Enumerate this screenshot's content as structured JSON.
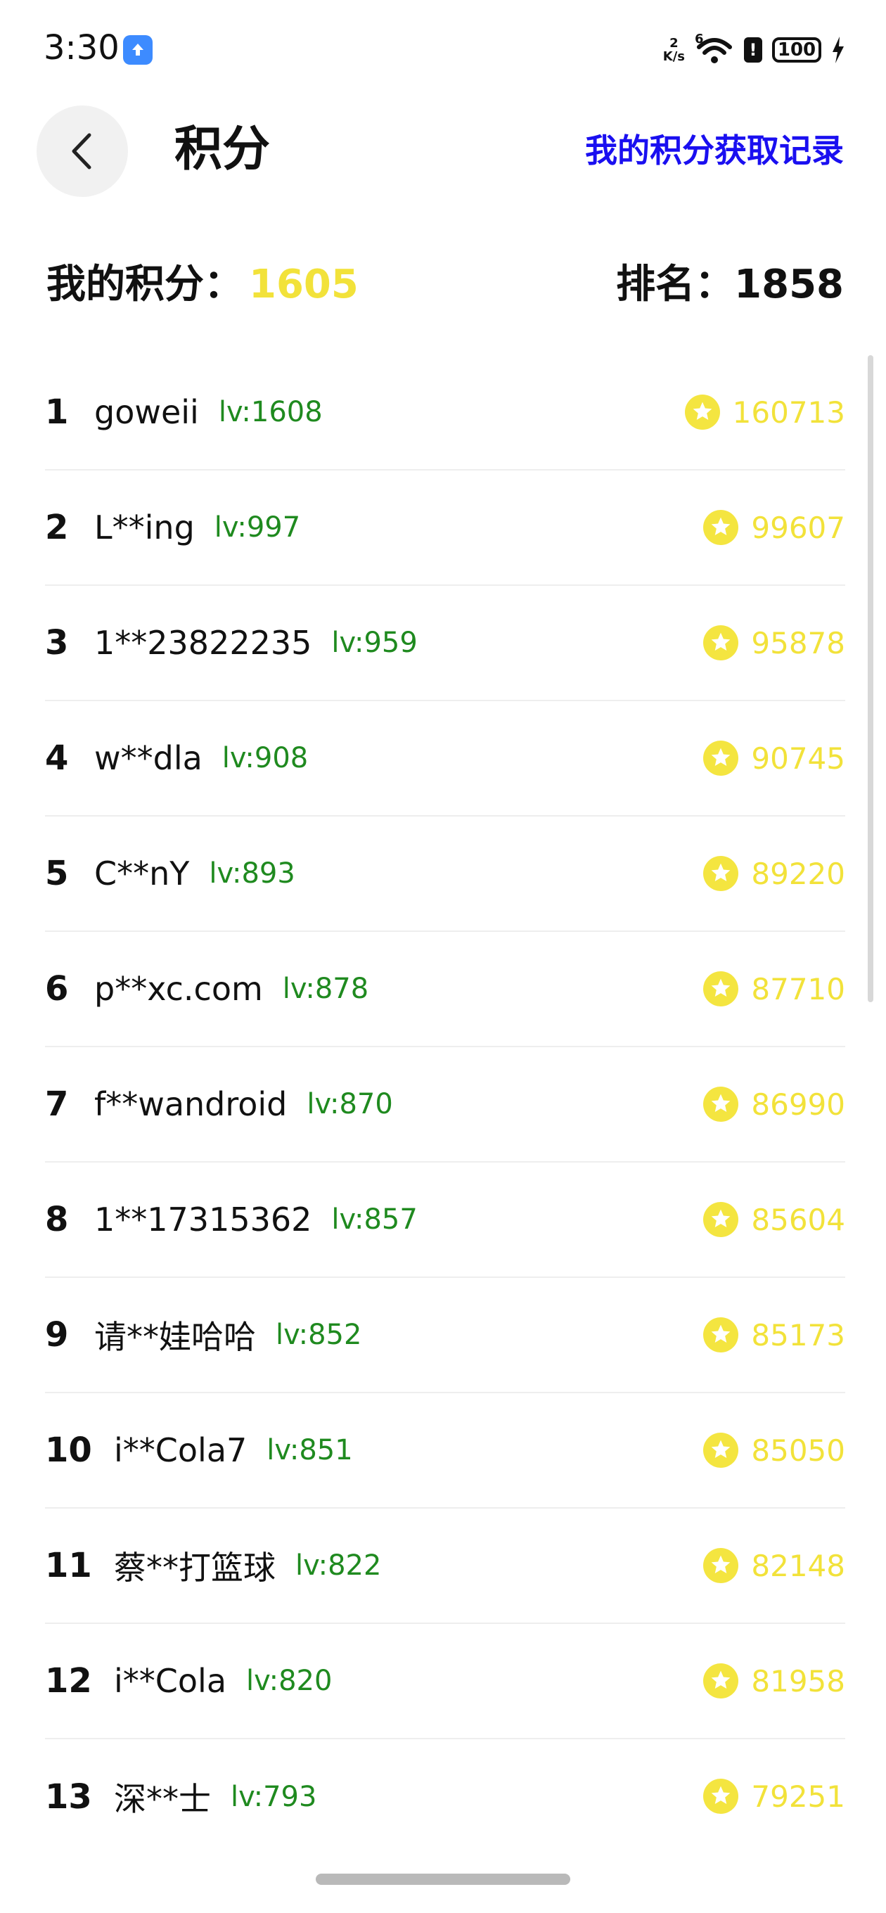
{
  "status_bar": {
    "time": "3:30",
    "speed_value": "2",
    "speed_unit": "K/s",
    "network": "6",
    "battery": "100",
    "icons": [
      "app-badge-icon",
      "wifi-icon",
      "alert-icon",
      "battery-icon",
      "charging-icon"
    ]
  },
  "header": {
    "title": "积分",
    "records_link": "我的积分获取记录"
  },
  "summary": {
    "my_points_label": "我的积分：",
    "my_points_value": "1605",
    "rank_label": "排名：",
    "rank_value": "1858"
  },
  "colors": {
    "accent_link": "#1a0ff0",
    "points_yellow": "#f2e23a",
    "level_green": "#1f8a1f"
  },
  "leaderboard": [
    {
      "rank": "1",
      "name": "goweii",
      "level": "lv:1608",
      "points": "160713"
    },
    {
      "rank": "2",
      "name": "L**ing",
      "level": "lv:997",
      "points": "99607"
    },
    {
      "rank": "3",
      "name": "1**23822235",
      "level": "lv:959",
      "points": "95878"
    },
    {
      "rank": "4",
      "name": "w**dla",
      "level": "lv:908",
      "points": "90745"
    },
    {
      "rank": "5",
      "name": "C**nY",
      "level": "lv:893",
      "points": "89220"
    },
    {
      "rank": "6",
      "name": "p**xc.com",
      "level": "lv:878",
      "points": "87710"
    },
    {
      "rank": "7",
      "name": "f**wandroid",
      "level": "lv:870",
      "points": "86990"
    },
    {
      "rank": "8",
      "name": "1**17315362",
      "level": "lv:857",
      "points": "85604"
    },
    {
      "rank": "9",
      "name": "请**娃哈哈",
      "level": "lv:852",
      "points": "85173"
    },
    {
      "rank": "10",
      "name": "i**Cola7",
      "level": "lv:851",
      "points": "85050"
    },
    {
      "rank": "11",
      "name": "蔡**打篮球",
      "level": "lv:822",
      "points": "82148"
    },
    {
      "rank": "12",
      "name": "i**Cola",
      "level": "lv:820",
      "points": "81958"
    },
    {
      "rank": "13",
      "name": "深**士",
      "level": "lv:793",
      "points": "79251"
    }
  ]
}
